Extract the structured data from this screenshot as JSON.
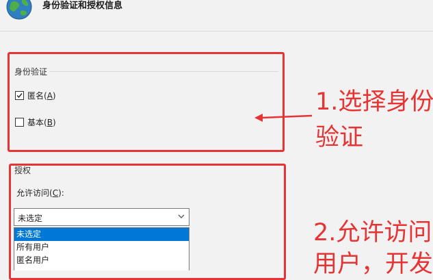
{
  "header": {
    "title": "身份验证和授权信息"
  },
  "authentication": {
    "group_title": "身份验证",
    "options": [
      {
        "label": "匿名",
        "accelerator": "A",
        "checked": true
      },
      {
        "label": "基本",
        "accelerator": "B",
        "checked": false
      }
    ]
  },
  "authorization": {
    "group_title": "授权",
    "allow_access_label": "允许访问",
    "allow_access_accel": "C",
    "select_value": "未选定",
    "dropdown_options": [
      {
        "label": "未选定",
        "highlighted": true
      },
      {
        "label": "所有用户",
        "highlighted": false
      },
      {
        "label": "匿名用户",
        "highlighted": false
      }
    ]
  },
  "annotations": {
    "step1_line1": "1.选择身份",
    "step1_line2": "验证",
    "step2_line1": "2.允许访问",
    "step2_line2": "用户，开发"
  },
  "colors": {
    "annotation_red": "#e63333",
    "selection_blue": "#0078d7"
  }
}
